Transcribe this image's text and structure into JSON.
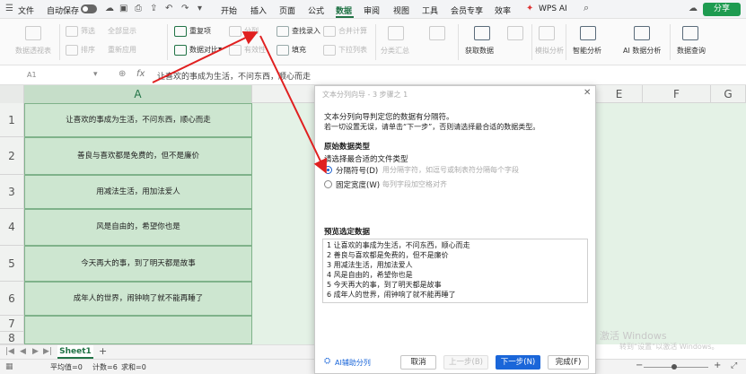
{
  "topbar": {
    "file": "文件",
    "autosave": "自动保存",
    "tabs": [
      "开始",
      "插入",
      "页面",
      "公式",
      "数据",
      "审阅",
      "视图",
      "工具",
      "会员专享",
      "效率"
    ],
    "active_tab": "数据",
    "wps_ai": "WPS AI",
    "share": "分享"
  },
  "ribbon": {
    "pivot": "数据透视表",
    "filter": "筛选",
    "reapply": "全部显示",
    "reapply2": "重新应用",
    "sort": "排序",
    "dup": "重复项",
    "compare": "数据对比",
    "split": "分列",
    "valid": "有效性",
    "lookup": "查找录入",
    "fill": "填充",
    "merge": "合并计算",
    "dropdown": "下拉列表",
    "subtotal": "分类汇总",
    "get_data": "获取数据",
    "simulate": "模拟分析",
    "smart": "智能分析",
    "ai_analysis": "AI 数据分析",
    "query": "数据查询",
    "colors": {
      "accent": "#217346",
      "link": "#1a66d9"
    }
  },
  "formula_bar": {
    "cell_ref": "A1",
    "fx": "fx",
    "value": "让喜欢的事成为生活，不问东西，顺心而走"
  },
  "grid": {
    "columns": [
      "A",
      "E",
      "F",
      "G"
    ],
    "rows": [
      "1",
      "2",
      "3",
      "4",
      "5",
      "6",
      "7",
      "8"
    ],
    "cells": [
      "让喜欢的事成为生活，不问东西，顺心而走",
      "善良与喜欢都是免费的，但不是廉价",
      "用减法生活，用加法爱人",
      "风是自由的，希望你也是",
      "今天再大的事，到了明天都是故事",
      "成年人的世界，闹钟响了就不能再睡了"
    ]
  },
  "sheetbar": {
    "sheet": "Sheet1",
    "add": "+"
  },
  "statusbar": {
    "avg": "平均值=0",
    "count": "计数=6",
    "sum": "求和=0"
  },
  "dialog": {
    "title": "文本分列向导 - 3 步骤之 1",
    "intro1": "文本分列向导判定您的数据有分隔符。",
    "intro2": "若一切设置无误，请单击“下一步”，否则请选择最合适的数据类型。",
    "section": "原始数据类型",
    "choose": "请选择最合适的文件类型",
    "opt1": "分隔符号(D)",
    "opt1_desc": "用分隔字符，如逗号或制表符分隔每个字段",
    "opt2": "固定宽度(W)",
    "opt2_desc": "每列字段加空格对齐",
    "preview_label": "预览选定数据",
    "preview": [
      "1 让喜欢的事成为生活，不问东西，顺心而走",
      "2 善良与喜欢都是免费的，但不是廉价",
      "3 用减法生活，用加法爱人",
      "4 风是自由的，希望你也是",
      "5 今天再大的事，到了明天都是故事",
      "6 成年人的世界，闹钟响了就不能再睡了"
    ],
    "ai_split": "AI辅助分列",
    "cancel": "取消",
    "prev": "上一步(B)",
    "next": "下一步(N)",
    "finish": "完成(F)"
  },
  "watermark": {
    "line1": "激活 Windows",
    "line2": "转到“设置”以激活 Windows。"
  }
}
